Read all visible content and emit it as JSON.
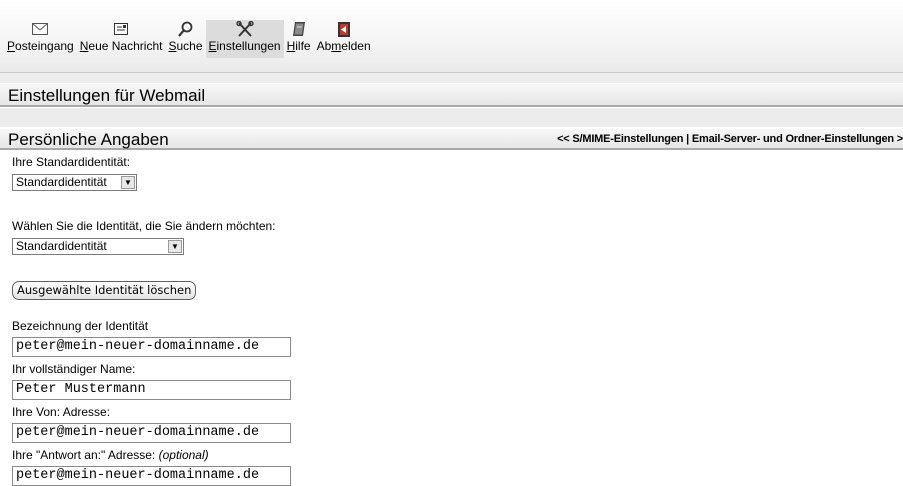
{
  "toolbar": {
    "items": [
      {
        "id": "inbox",
        "icon": "envelope-icon",
        "pre": "",
        "key": "P",
        "post": "osteingang"
      },
      {
        "id": "compose",
        "icon": "new-message-icon",
        "pre": "",
        "key": "N",
        "post": "eue Nachricht"
      },
      {
        "id": "search",
        "icon": "magnifier-icon",
        "pre": "",
        "key": "S",
        "post": "uche"
      },
      {
        "id": "settings",
        "icon": "tools-icon",
        "pre": "",
        "key": "E",
        "post": "instellungen",
        "active": true
      },
      {
        "id": "help",
        "icon": "help-book-icon",
        "pre": "",
        "key": "H",
        "post": "ilfe"
      },
      {
        "id": "logout",
        "icon": "logout-door-icon",
        "pre": "Ab",
        "key": "m",
        "post": "elden"
      }
    ]
  },
  "page_title": "Einstellungen für Webmail",
  "section": {
    "title": "Persönliche Angaben",
    "links": {
      "prev": "<< S/MIME-Einstellungen",
      "divider": " | ",
      "next": "Email-Server- und Ordner-Einstellungen >"
    }
  },
  "form": {
    "default_identity_label": "Ihre Standardidentität:",
    "default_identity_value": "Standardidentität",
    "choose_identity_label": "Wählen Sie die Identität, die Sie ändern möchten:",
    "choose_identity_value": "Standardidentität",
    "delete_button": "Ausgewählte Identität löschen",
    "identity_name_label": "Bezeichnung der Identität",
    "identity_name_value": "peter@mein-neuer-domainname.de",
    "fullname_label": "Ihr vollständiger Name:",
    "fullname_value": "Peter Mustermann",
    "from_label": "Ihre Von: Adresse:",
    "from_value": "peter@mein-neuer-domainname.de",
    "replyto_label": "Ihre \"Antwort an:\" Adresse:",
    "replyto_optional": "(optional)",
    "replyto_value": "peter@mein-neuer-domainname.de"
  }
}
